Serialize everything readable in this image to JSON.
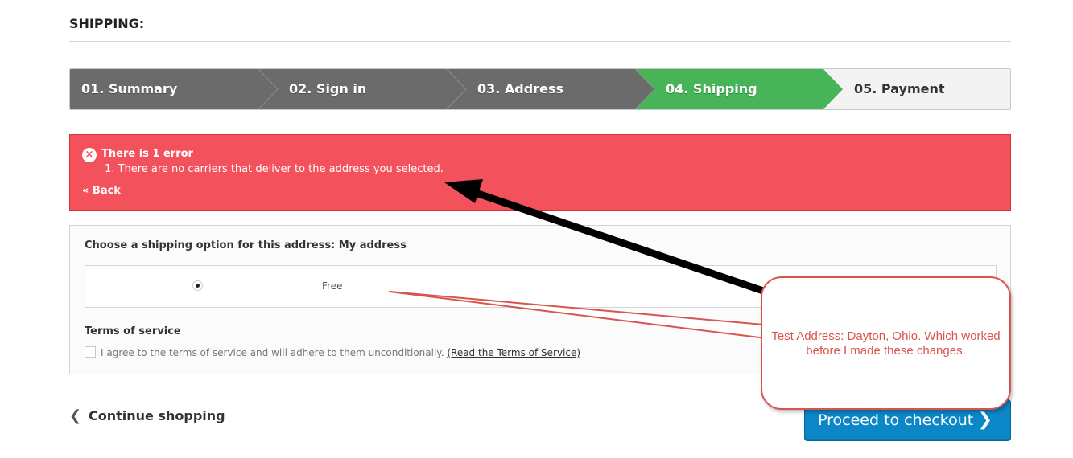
{
  "page": {
    "heading": "SHIPPING:"
  },
  "steps": [
    {
      "label": "01. Summary",
      "state": "done"
    },
    {
      "label": "02. Sign in",
      "state": "done"
    },
    {
      "label": "03. Address",
      "state": "done"
    },
    {
      "label": "04. Shipping",
      "state": "current"
    },
    {
      "label": "05. Payment",
      "state": "todo"
    }
  ],
  "colors": {
    "step_done": "#6b6b6b",
    "step_current": "#46b457",
    "step_todo": "#f3f3f3",
    "error_bg": "#f3515c",
    "checkout_button": "#0b86c7",
    "annotation_red": "#d9534f",
    "annotation_arrow": "#000000"
  },
  "alert": {
    "icon": "close-circle-icon",
    "title": "There is 1 error",
    "items": [
      "1. There are no carriers that deliver to the address you selected."
    ],
    "back_link": "« Back"
  },
  "delivery": {
    "title": "Choose a shipping option for this address: My address",
    "options": [
      {
        "selected": true,
        "label": "Free"
      }
    ],
    "terms_title": "Terms of service",
    "terms_checked": false,
    "terms_text": "I agree to the terms of service and will adhere to them unconditionally.",
    "terms_link": "(Read the Terms of Service)"
  },
  "nav": {
    "continue_label": "Continue shopping",
    "continue_icon": "chevron-left-icon",
    "proceed_label": "Proceed to checkout",
    "proceed_icon": "chevron-right-icon"
  },
  "annotation": {
    "callout_text": "Test Address: Dayton, Ohio. Which worked before I made these changes."
  }
}
